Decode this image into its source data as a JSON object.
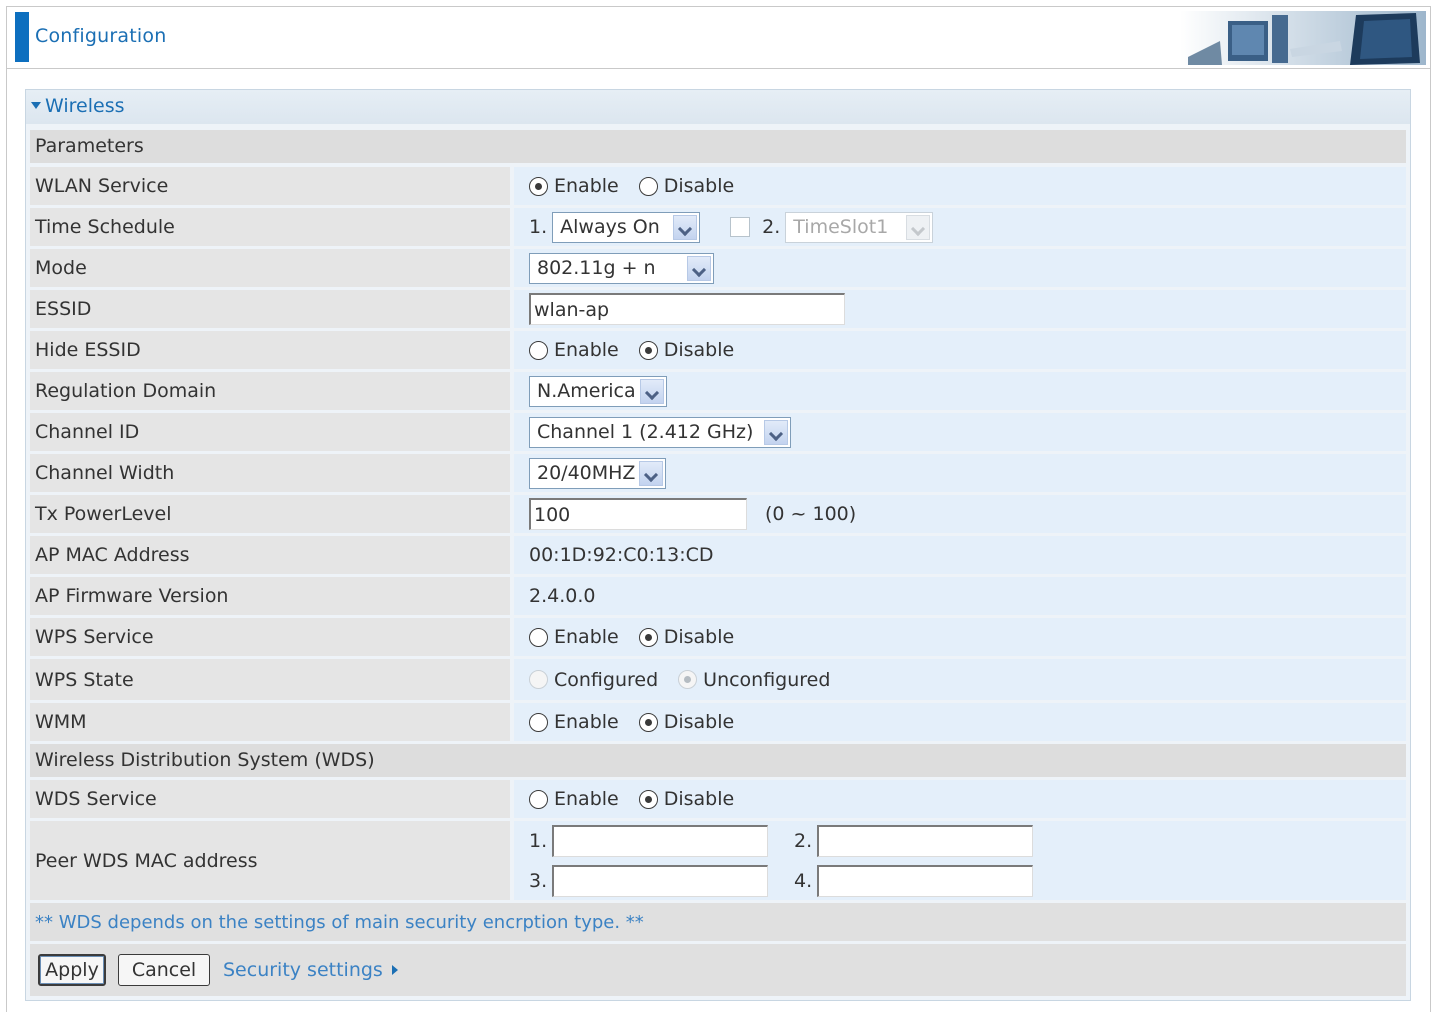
{
  "header": {
    "title": "Configuration"
  },
  "panel": {
    "title": "Wireless"
  },
  "sections": {
    "parameters": "Parameters",
    "wds": "Wireless Distribution System (WDS)"
  },
  "fields": {
    "wlan_service": {
      "label": "WLAN Service",
      "options": [
        "Enable",
        "Disable"
      ],
      "selected": "Enable"
    },
    "time_schedule": {
      "label": "Time Schedule",
      "num1": "1.",
      "slot1": "Always On",
      "num2": "2.",
      "slot2": "TimeSlot1",
      "slot2_checked": false
    },
    "mode": {
      "label": "Mode",
      "value": "802.11g + n"
    },
    "essid": {
      "label": "ESSID",
      "value": "wlan-ap"
    },
    "hide_essid": {
      "label": "Hide ESSID",
      "options": [
        "Enable",
        "Disable"
      ],
      "selected": "Disable"
    },
    "regulation_domain": {
      "label": "Regulation Domain",
      "value": "N.America"
    },
    "channel_id": {
      "label": "Channel ID",
      "value": "Channel 1 (2.412 GHz)"
    },
    "channel_width": {
      "label": "Channel Width",
      "value": "20/40MHZ"
    },
    "tx_power": {
      "label": "Tx PowerLevel",
      "value": "100",
      "range": "(0 ~ 100)"
    },
    "ap_mac": {
      "label": "AP MAC Address",
      "value": "00:1D:92:C0:13:CD"
    },
    "ap_firmware": {
      "label": "AP Firmware Version",
      "value": "2.4.0.0"
    },
    "wps_service": {
      "label": "WPS Service",
      "options": [
        "Enable",
        "Disable"
      ],
      "selected": "Disable"
    },
    "wps_state": {
      "label": "WPS State",
      "options": [
        "Configured",
        "Unconfigured"
      ],
      "selected": "Unconfigured"
    },
    "wmm": {
      "label": "WMM",
      "options": [
        "Enable",
        "Disable"
      ],
      "selected": "Disable"
    },
    "wds_service": {
      "label": "WDS Service",
      "options": [
        "Enable",
        "Disable"
      ],
      "selected": "Disable"
    },
    "peer_wds": {
      "label": "Peer WDS MAC address",
      "nums": [
        "1.",
        "2.",
        "3.",
        "4."
      ],
      "values": [
        "",
        "",
        "",
        ""
      ]
    }
  },
  "note": "** WDS depends on the settings of main security encrption type. **",
  "buttons": {
    "apply": "Apply",
    "cancel": "Cancel",
    "security_link": "Security settings"
  },
  "colors": {
    "accent": "#1b6fb4",
    "label_bg": "#e5e5e5",
    "value_bg": "#e4effa",
    "section_bg": "#dddddd"
  }
}
